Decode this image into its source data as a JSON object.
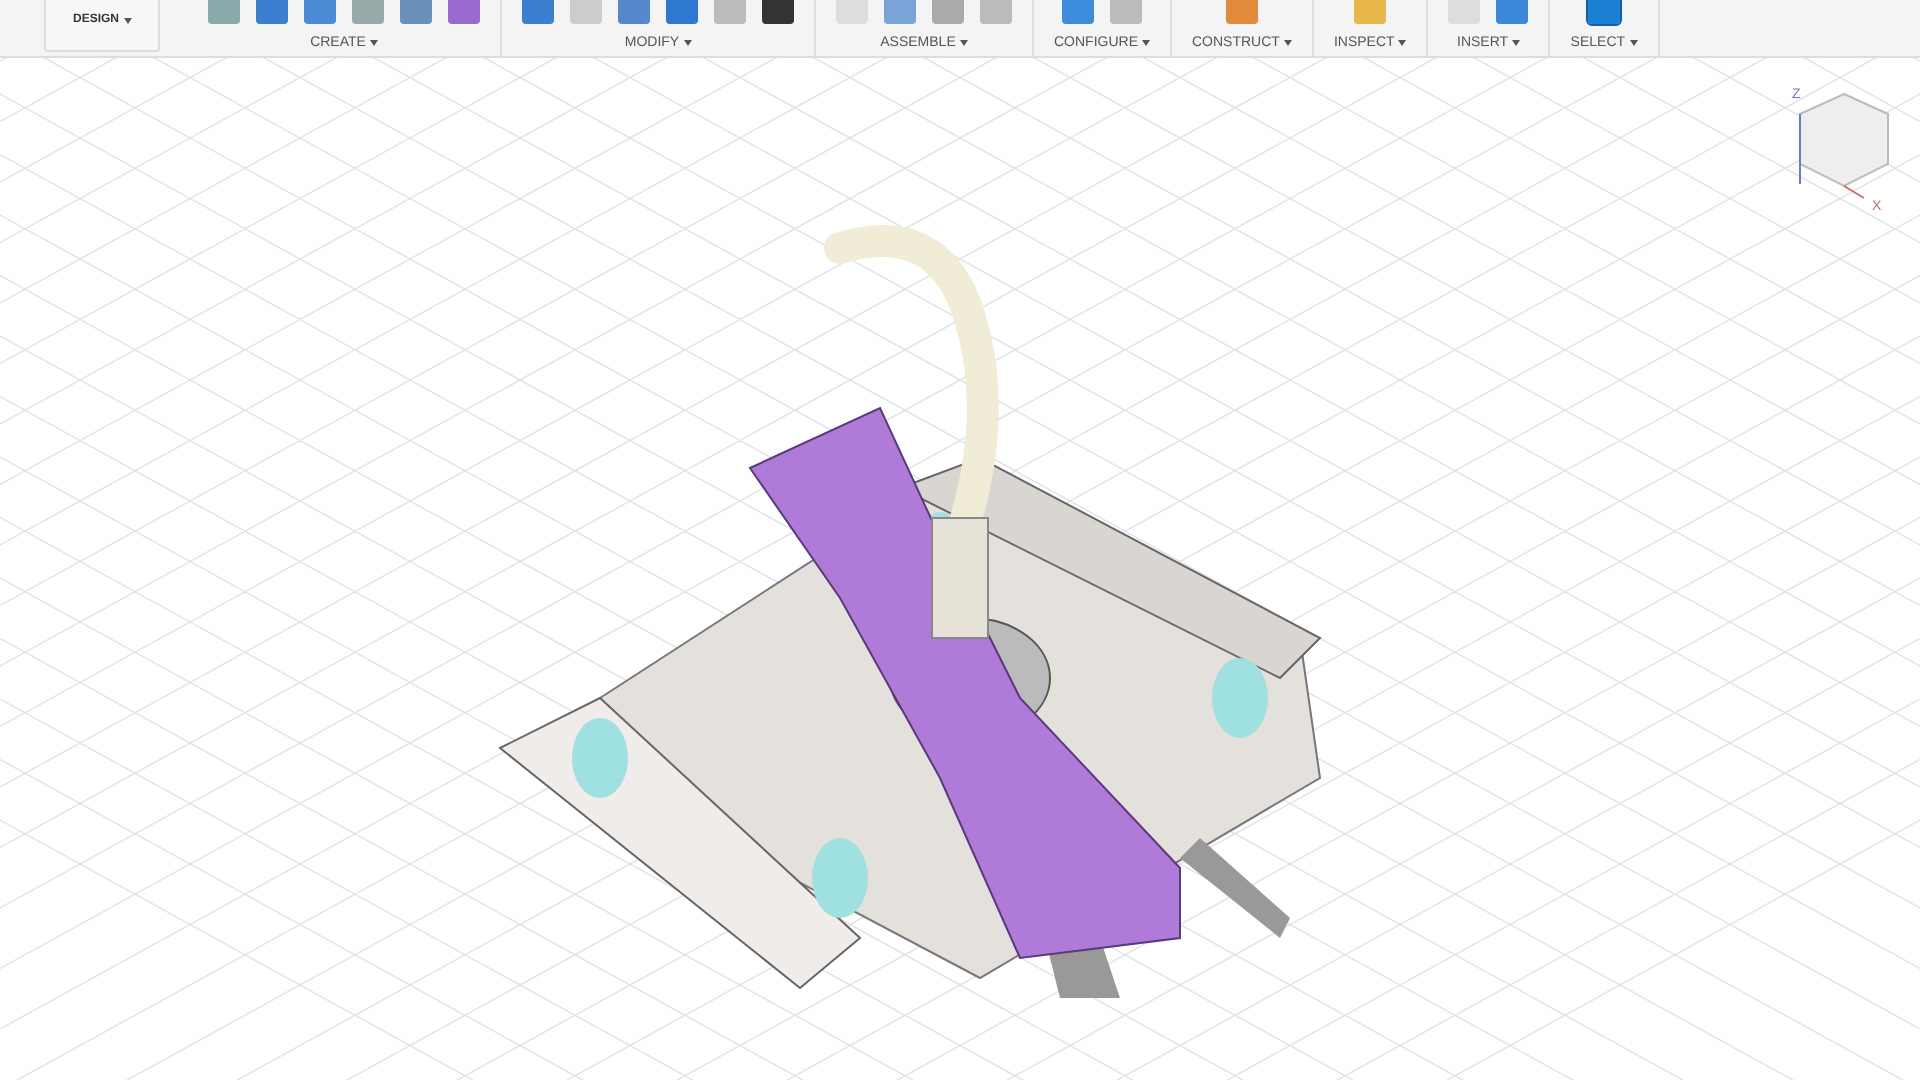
{
  "workspace_menu": {
    "label": "DESIGN"
  },
  "toolbar_groups": [
    {
      "label": "CREATE",
      "tools": [
        {
          "kind": "sketch"
        },
        {
          "kind": "box"
        },
        {
          "kind": "cylinder"
        },
        {
          "kind": "revolve"
        },
        {
          "kind": "line"
        },
        {
          "kind": "shell"
        }
      ]
    },
    {
      "label": "MODIFY",
      "tools": [
        {
          "kind": "press"
        },
        {
          "kind": "fillet"
        },
        {
          "kind": "chamfer"
        },
        {
          "kind": "combine"
        },
        {
          "kind": "split"
        },
        {
          "kind": "move"
        }
      ]
    },
    {
      "label": "ASSEMBLE",
      "tools": [
        {
          "kind": "joint"
        },
        {
          "kind": "component"
        },
        {
          "kind": "origin"
        },
        {
          "kind": "table"
        }
      ]
    },
    {
      "label": "CONFIGURE",
      "tools": [
        {
          "kind": "params"
        },
        {
          "kind": "table"
        }
      ]
    },
    {
      "label": "CONSTRUCT",
      "tools": [
        {
          "kind": "plane"
        }
      ]
    },
    {
      "label": "INSPECT",
      "tools": [
        {
          "kind": "measure"
        }
      ]
    },
    {
      "label": "INSERT",
      "tools": [
        {
          "kind": "doc"
        },
        {
          "kind": "image"
        }
      ]
    },
    {
      "label": "SELECT",
      "tools": [
        {
          "kind": "select"
        }
      ],
      "selected": true
    }
  ],
  "view_cube": {
    "axes": [
      {
        "label": "Z",
        "kind": "up"
      },
      {
        "label": "X",
        "kind": "side"
      }
    ]
  }
}
